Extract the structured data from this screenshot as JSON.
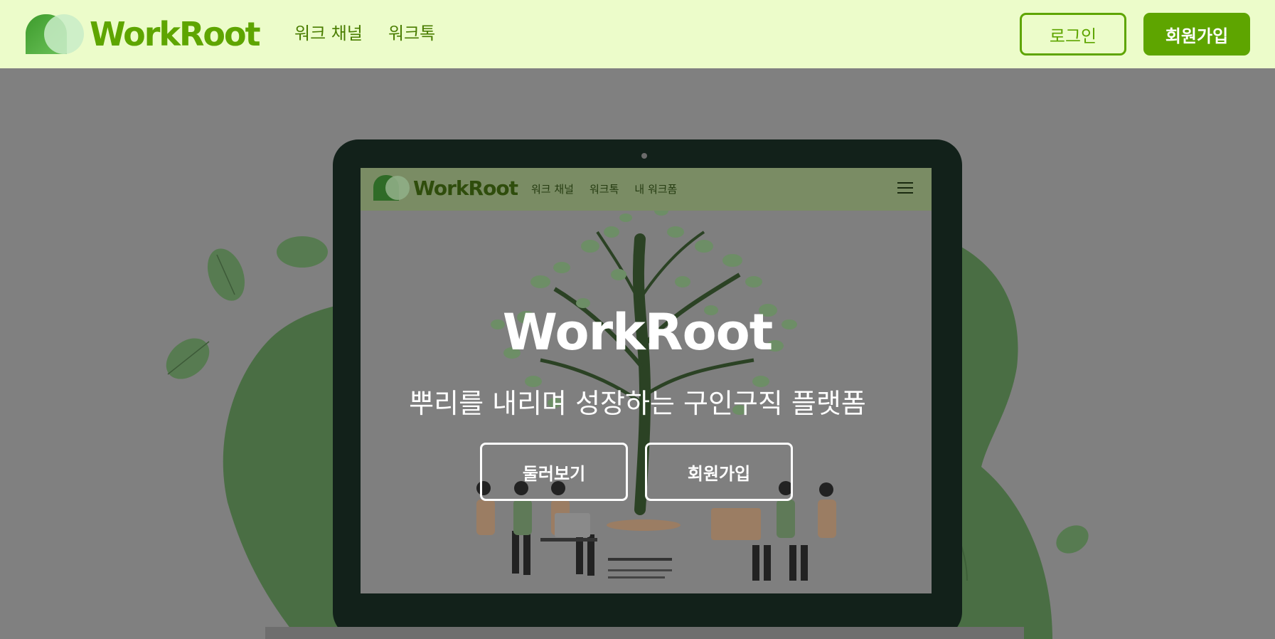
{
  "header": {
    "logo_text": "WorkRoot",
    "nav": [
      {
        "label": "워크 채널"
      },
      {
        "label": "워크톡"
      }
    ],
    "login_label": "로그인",
    "signup_label": "회원가입"
  },
  "hero": {
    "inner_screen": {
      "logo_text": "WorkRoot",
      "nav": [
        {
          "label": "워크 채널"
        },
        {
          "label": "워크톡"
        },
        {
          "label": "내 워크폼"
        }
      ],
      "menu_icon": "hamburger-icon"
    },
    "title": "WorkRoot",
    "subtitle": "뿌리를 내리며 성장하는 구인구직 플랫폼",
    "explore_label": "둘러보기",
    "signup_label": "회원가입"
  },
  "colors": {
    "brand": "#5ea500",
    "header_bg": "#ecfcca",
    "hero_bg": "#808080",
    "laptop": "#12211a"
  }
}
